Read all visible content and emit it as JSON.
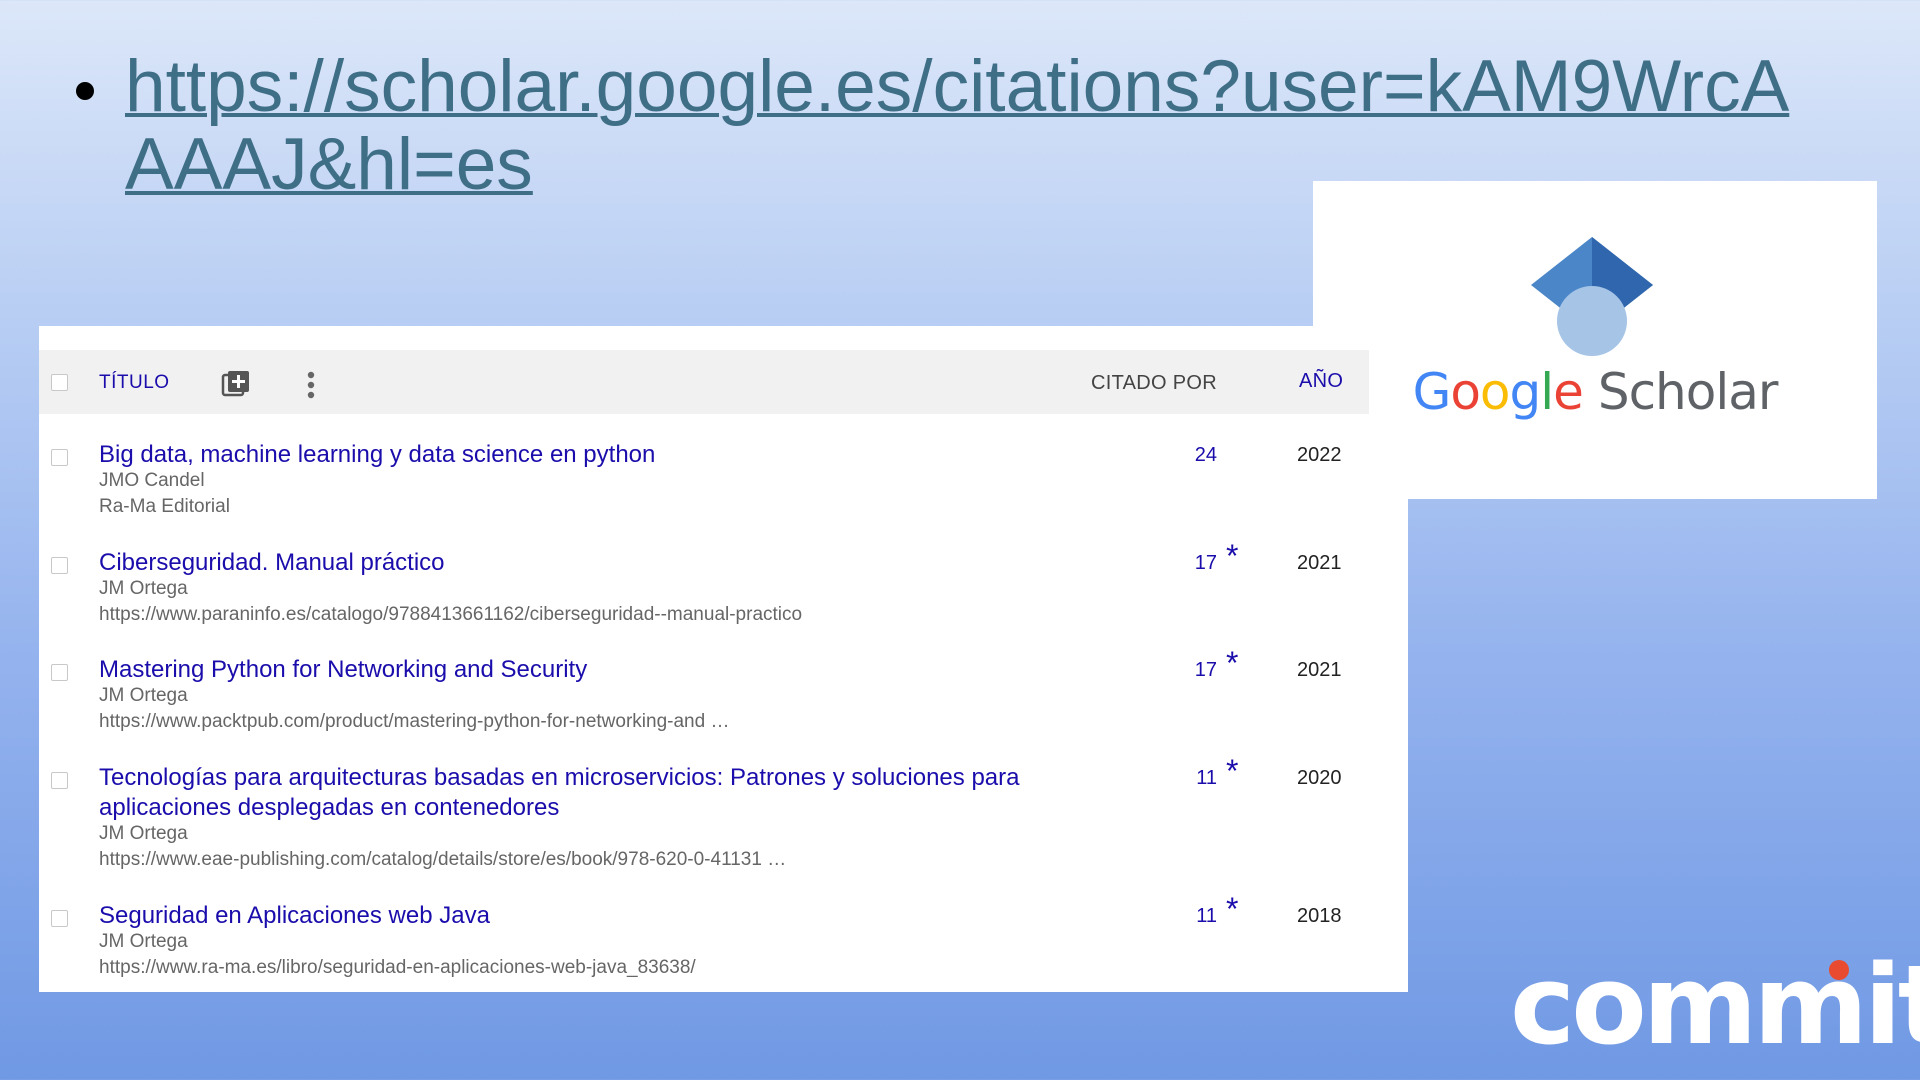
{
  "slide": {
    "link_text": "https://scholar.google.es/citations?user=kAM9WrcAAAAJ&hl=es"
  },
  "logo": {
    "brand_google": [
      "G",
      "o",
      "o",
      "g",
      "l",
      "e"
    ],
    "brand_scholar": "Scholar",
    "cap_icon": "graduation-cap-icon"
  },
  "table": {
    "header": {
      "title_label": "TÍTULO",
      "cited_label": "CITADO POR",
      "year_label": "AÑO",
      "add_icon": "add-to-library-icon",
      "more_icon": "more-vert-icon"
    },
    "rows": [
      {
        "title": "Big data, machine learning y data science en python",
        "authors": "JMO Candel",
        "venue": "Ra-Ma Editorial",
        "cites": "24",
        "star": "",
        "year": "2022"
      },
      {
        "title": "Ciberseguridad. Manual práctico",
        "authors": "JM Ortega",
        "venue": "https://www.paraninfo.es/catalogo/9788413661162/ciberseguridad--manual-practico",
        "cites": "17",
        "star": "*",
        "year": "2021"
      },
      {
        "title": "Mastering Python for Networking and Security",
        "authors": "JM Ortega",
        "venue": "https://www.packtpub.com/product/mastering-python-for-networking-and …",
        "cites": "17",
        "star": "*",
        "year": "2021"
      },
      {
        "title": "Tecnologías para arquitecturas basadas en microservicios: Patrones y soluciones para aplicaciones desplegadas en contenedores",
        "authors": "JM Ortega",
        "venue": "https://www.eae-publishing.com/catalog/details/store/es/book/978-620-0-41131 …",
        "cites": "11",
        "star": "*",
        "year": "2020"
      },
      {
        "title": "Seguridad en Aplicaciones web Java",
        "authors": "JM Ortega",
        "venue": "https://www.ra-ma.es/libro/seguridad-en-aplicaciones-web-java_83638/",
        "cites": "11",
        "star": "*",
        "year": "2018"
      }
    ]
  },
  "footer": {
    "brand": "commit"
  }
}
